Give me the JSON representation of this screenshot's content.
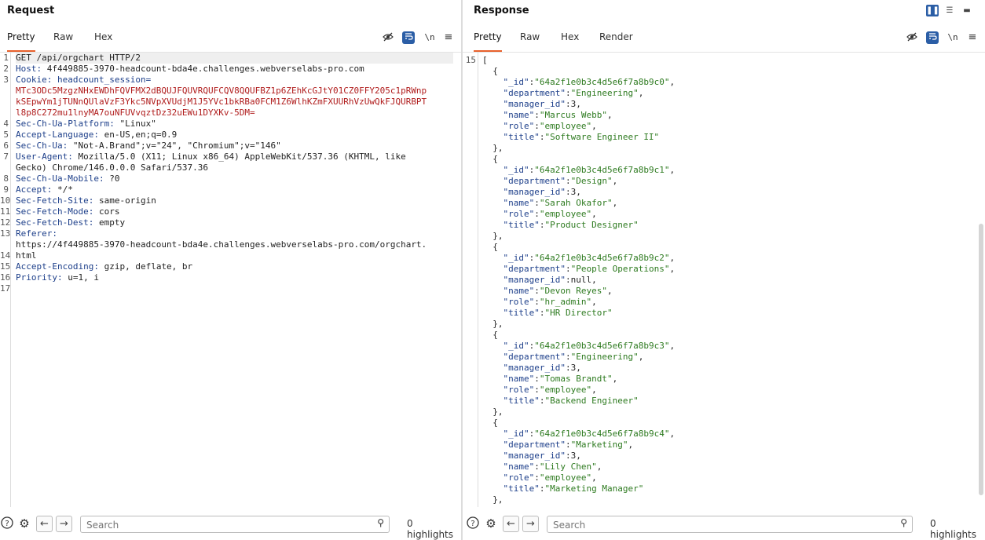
{
  "request": {
    "title": "Request",
    "tabs": [
      "Pretty",
      "Raw",
      "Hex"
    ],
    "active_tab": "Pretty",
    "line_numbers": [
      "1",
      "2",
      "3",
      "",
      "",
      "",
      "4",
      "5",
      "6",
      "7",
      "",
      "8",
      "9",
      "10",
      "11",
      "12",
      "13",
      "",
      "14",
      "15",
      "16",
      "17"
    ],
    "lines": [
      {
        "key": "GET /api/orgchart HTTP/2",
        "value": ""
      },
      {
        "key": "Host:",
        "value": " 4f449885-3970-headcount-bda4e.challenges.webverselabs-pro.com"
      },
      {
        "key": "Cookie: headcount_session=",
        "value": ""
      },
      {
        "cookie": "MTc3ODc5MzgzNHxEWDhFQVFMX2dBQUJFQUVRQUFCQV8QQUFBZ1p6ZEhKcGJtY01CZ0FFY205c1pRWnp"
      },
      {
        "cookie": "kSEpwYm1jTUNnQUlaVzF3Ykc5NVpXVUdjM1J5YVc1bkRBa0FCM1Z6WlhKZmFXUURhVzUwQkFJQURBPT"
      },
      {
        "cookie": "l8p8C272mu1lnyMA7ouNFUVvqztDz32uEWu1DYXKv-5DM="
      },
      {
        "key": "Sec-Ch-Ua-Platform:",
        "value": " \"Linux\""
      },
      {
        "key": "Accept-Language:",
        "value": " en-US,en;q=0.9"
      },
      {
        "key": "Sec-Ch-Ua:",
        "value": " \"Not-A.Brand\";v=\"24\", \"Chromium\";v=\"146\""
      },
      {
        "key": "User-Agent:",
        "value": " Mozilla/5.0 (X11; Linux x86_64) AppleWebKit/537.36 (KHTML, like"
      },
      {
        "key": "",
        "value": "Gecko) Chrome/146.0.0.0 Safari/537.36"
      },
      {
        "key": "Sec-Ch-Ua-Mobile:",
        "value": " ?0"
      },
      {
        "key": "Accept:",
        "value": " */*"
      },
      {
        "key": "Sec-Fetch-Site:",
        "value": " same-origin"
      },
      {
        "key": "Sec-Fetch-Mode:",
        "value": " cors"
      },
      {
        "key": "Sec-Fetch-Dest:",
        "value": " empty"
      },
      {
        "key": "Referer:",
        "value": ""
      },
      {
        "key": "",
        "value": "https://4f449885-3970-headcount-bda4e.challenges.webverselabs-pro.com/orgchart."
      },
      {
        "key": "",
        "value": "html"
      },
      {
        "key": "Accept-Encoding:",
        "value": " gzip, deflate, br"
      },
      {
        "key": "Priority:",
        "value": " u=1, i"
      },
      {
        "key": "",
        "value": ""
      },
      {
        "key": "",
        "value": ""
      }
    ],
    "search_placeholder": "Search",
    "highlights": "0 highlights"
  },
  "response": {
    "title": "Response",
    "tabs": [
      "Pretty",
      "Raw",
      "Hex",
      "Render"
    ],
    "active_tab": "Pretty",
    "first_line_number": "15",
    "records": [
      {
        "_id": "\"64a2f1e0b3c4d5e6f7a8b9c0\"",
        "department": "\"Engineering\"",
        "manager_id": "3",
        "name": "\"Marcus Webb\"",
        "role": "\"employee\"",
        "title": "\"Software Engineer II\""
      },
      {
        "_id": "\"64a2f1e0b3c4d5e6f7a8b9c1\"",
        "department": "\"Design\"",
        "manager_id": "3",
        "name": "\"Sarah Okafor\"",
        "role": "\"employee\"",
        "title": "\"Product Designer\""
      },
      {
        "_id": "\"64a2f1e0b3c4d5e6f7a8b9c2\"",
        "department": "\"People Operations\"",
        "manager_id": "null",
        "name": "\"Devon Reyes\"",
        "role": "\"hr_admin\"",
        "title": "\"HR Director\""
      },
      {
        "_id": "\"64a2f1e0b3c4d5e6f7a8b9c3\"",
        "department": "\"Engineering\"",
        "manager_id": "3",
        "name": "\"Tomas Brandt\"",
        "role": "\"employee\"",
        "title": "\"Backend Engineer\""
      },
      {
        "_id": "\"64a2f1e0b3c4d5e6f7a8b9c4\"",
        "department": "\"Marketing\"",
        "manager_id": "3",
        "name": "\"Lily Chen\"",
        "role": "\"employee\"",
        "title": "\"Marketing Manager\""
      }
    ],
    "search_placeholder": "Search",
    "highlights": "0 highlights"
  },
  "icons": {
    "hide": "eye-slash-icon",
    "wrap": "wrap-icon",
    "newline": "\\n",
    "menu": "menu-icon"
  },
  "colors": {
    "accent_tab": "#e8612c",
    "toggle_blue": "#2b5ea6",
    "header_key": "#1d3f8a",
    "cookie_value": "#b01c1c",
    "json_string": "#2d7a1f"
  }
}
